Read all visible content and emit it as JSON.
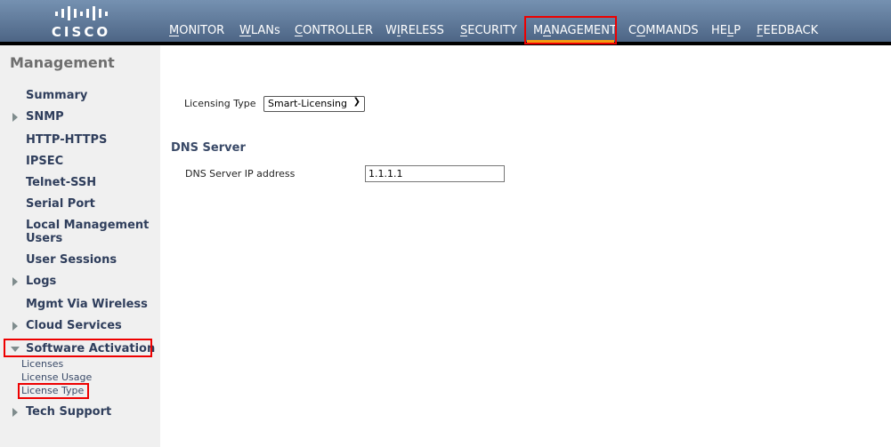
{
  "logo": {
    "text": "CISCO"
  },
  "nav": [
    {
      "label": "MONITOR",
      "u": 0
    },
    {
      "label": "WLANs",
      "u": 0
    },
    {
      "label": "CONTROLLER",
      "u": 0
    },
    {
      "label": "WIRELESS",
      "u": 1
    },
    {
      "label": "SECURITY",
      "u": 0
    },
    {
      "label": "MANAGEMENT",
      "u": 1,
      "active": true
    },
    {
      "label": "COMMANDS",
      "u": 1
    },
    {
      "label": "HELP",
      "u": 2
    },
    {
      "label": "FEEDBACK",
      "u": 0
    }
  ],
  "sidebar": {
    "title": "Management",
    "items": [
      "Summary",
      "SNMP",
      "HTTP-HTTPS",
      "IPSEC",
      "Telnet-SSH",
      "Serial Port",
      "Local Management Users",
      "User Sessions",
      "Logs",
      "Mgmt Via Wireless",
      "Cloud Services",
      "Software Activation",
      "Tech Support"
    ],
    "subitems": [
      "Licenses",
      "License Usage",
      "License Type"
    ]
  },
  "main": {
    "licensing_type_label": "Licensing Type",
    "licensing_type_value": "Smart-Licensing",
    "dns_heading": "DNS Server",
    "dns_ip_label": "DNS Server IP address",
    "dns_ip_value": "1.1.1.1"
  },
  "colors": {
    "highlight": "#ee0000",
    "active_tab": "#f39c12"
  }
}
